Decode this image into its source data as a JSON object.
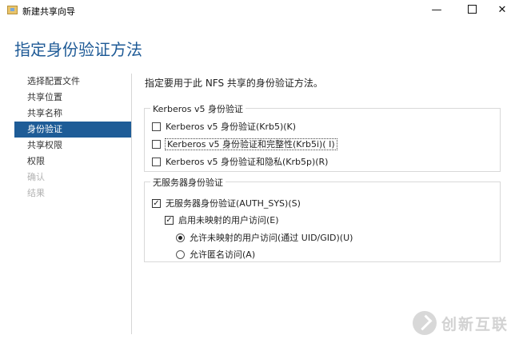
{
  "window": {
    "title": "新建共享向导",
    "minimize_glyph": "—",
    "close_glyph": "✕"
  },
  "heading": "指定身份验证方法",
  "nav": {
    "items": [
      {
        "label": "选择配置文件",
        "state": "normal"
      },
      {
        "label": "共享位置",
        "state": "normal"
      },
      {
        "label": "共享名称",
        "state": "normal"
      },
      {
        "label": "身份验证",
        "state": "active"
      },
      {
        "label": "共享权限",
        "state": "normal"
      },
      {
        "label": "权限",
        "state": "normal"
      },
      {
        "label": "确认",
        "state": "disabled"
      },
      {
        "label": "结果",
        "state": "disabled"
      }
    ]
  },
  "instruction": "指定要用于此 NFS 共享的身份验证方法。",
  "kerberos": {
    "group_label": "Kerberos v5 身份验证",
    "options": [
      {
        "label": "Kerberos v5 身份验证(Krb5)(K)",
        "checked": false
      },
      {
        "label": "Kerberos v5 身份验证和完整性(Krb5i)( I)",
        "checked": false,
        "focused": true
      },
      {
        "label": "Kerberos v5 身份验证和隐私(Krb5p)(R)",
        "checked": false
      }
    ]
  },
  "no_server": {
    "group_label": "无服务器身份验证",
    "auth_sys": {
      "label": "无服务器身份验证(AUTH_SYS)(S)",
      "checked": true
    },
    "unmapped": {
      "label": "启用未映射的用户访问(E)",
      "checked": true
    },
    "radios": [
      {
        "label": "允许未映射的用户访问(通过 UID/GID)(U)",
        "selected": true
      },
      {
        "label": "允许匿名访问(A)",
        "selected": false
      }
    ]
  },
  "watermark": {
    "text": "创新互联"
  },
  "colors": {
    "accent": "#1e5c97",
    "heading": "#1e5a96"
  }
}
